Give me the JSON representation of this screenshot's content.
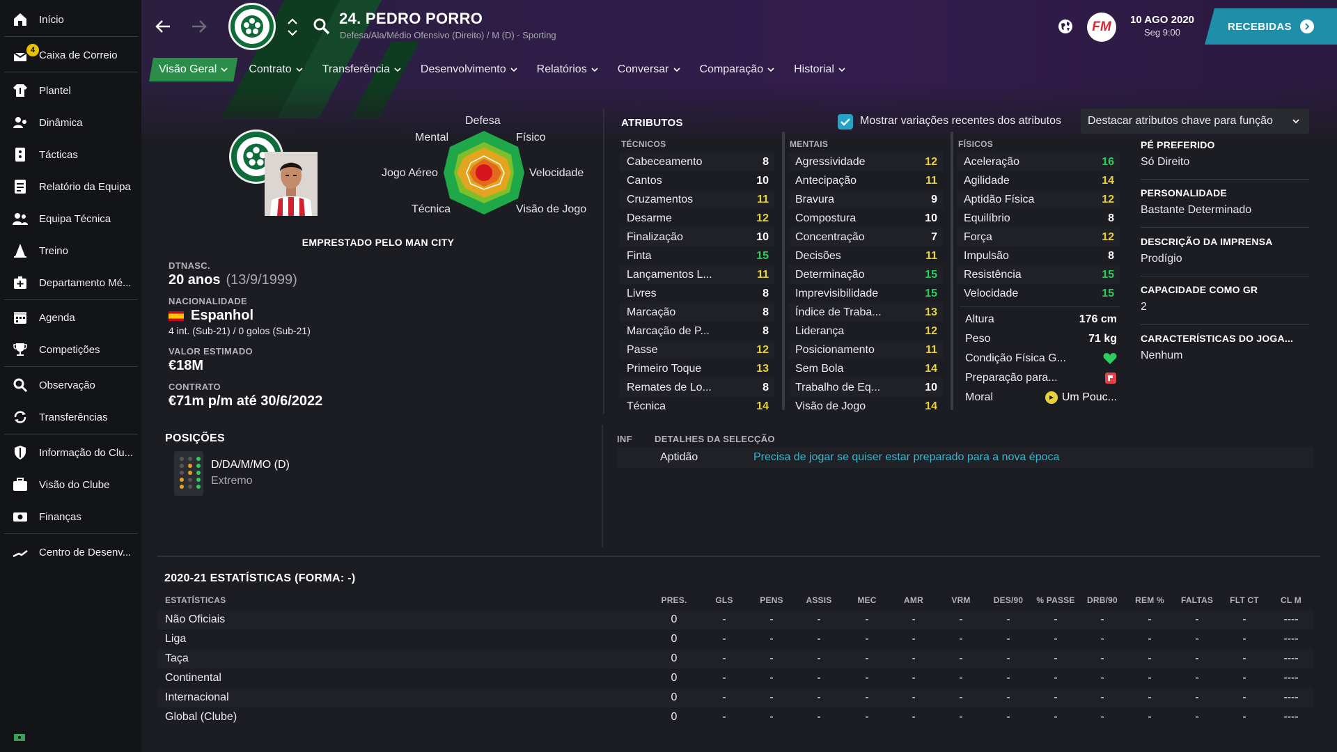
{
  "sidebar": {
    "items": [
      {
        "label": "Início",
        "icon": "home-icon"
      },
      {
        "label": "Caixa de Correio",
        "icon": "inbox-icon",
        "badge": "4"
      },
      {
        "label": "Plantel",
        "icon": "shirt-icon"
      },
      {
        "label": "Dinâmica",
        "icon": "dynamics-icon"
      },
      {
        "label": "Tácticas",
        "icon": "tactics-icon"
      },
      {
        "label": "Relatório da Equipa",
        "icon": "report-icon"
      },
      {
        "label": "Equipa Técnica",
        "icon": "staff-icon"
      },
      {
        "label": "Treino",
        "icon": "training-cone-icon"
      },
      {
        "label": "Departamento Mé...",
        "icon": "medical-icon"
      },
      {
        "label": "Agenda",
        "icon": "calendar-icon"
      },
      {
        "label": "Competições",
        "icon": "trophy-icon"
      },
      {
        "label": "Observação",
        "icon": "scouting-search-icon"
      },
      {
        "label": "Transferências",
        "icon": "transfers-icon"
      },
      {
        "label": "Informação do Clu...",
        "icon": "club-shield-icon"
      },
      {
        "label": "Visão do Clube",
        "icon": "briefcase-icon"
      },
      {
        "label": "Finanças",
        "icon": "money-icon"
      },
      {
        "label": "Centro de Desenv...",
        "icon": "development-icon"
      }
    ]
  },
  "header": {
    "player_name": "24. PEDRO PORRO",
    "player_subtitle": "Defesa/Ala/Médio Ofensivo (Direito) / M (D) - Sporting",
    "fm_logo": "FM",
    "date_main": "10 AGO 2020",
    "date_sub": "Seg 9:00",
    "received_label": "RECEBIDAS"
  },
  "tabs": [
    {
      "label": "Visão Geral",
      "active": true
    },
    {
      "label": "Contrato"
    },
    {
      "label": "Transferência"
    },
    {
      "label": "Desenvolvimento"
    },
    {
      "label": "Relatórios"
    },
    {
      "label": "Conversar"
    },
    {
      "label": "Comparação"
    },
    {
      "label": "Historial"
    }
  ],
  "profile": {
    "loan_text": "EMPRESTADO PELO MAN CITY",
    "radar_labels": {
      "defesa": "Defesa",
      "fisico": "Físico",
      "velocidade": "Velocidade",
      "visao": "Visão de Jogo",
      "tecnica": "Técnica",
      "jogo_aereo": "Jogo Aéreo",
      "mental": "Mental"
    },
    "dob_label": "DTNASC.",
    "age": "20 anos",
    "dob": "(13/9/1999)",
    "nationality_label": "NACIONALIDADE",
    "nationality": "Espanhol",
    "caps": "4 int. (Sub-21) / 0 golos (Sub-21)",
    "value_label": "VALOR ESTIMADO",
    "value": "€18M",
    "contract_label": "CONTRATO",
    "contract": "€71m p/m até 30/6/2022"
  },
  "attributes": {
    "title": "ATRIBUTOS",
    "show_changes_label": "Mostrar variações recentes dos atributos",
    "show_changes_checked": true,
    "highlight_dropdown": "Destacar atributos chave para função",
    "technical_label": "TÉCNICOS",
    "mental_label": "MENTAIS",
    "physical_label": "FÍSICOS",
    "technical": [
      {
        "name": "Cabeceamento",
        "value": "8"
      },
      {
        "name": "Cantos",
        "value": "10"
      },
      {
        "name": "Cruzamentos",
        "value": "11"
      },
      {
        "name": "Desarme",
        "value": "12"
      },
      {
        "name": "Finalização",
        "value": "10"
      },
      {
        "name": "Finta",
        "value": "15"
      },
      {
        "name": "Lançamentos L...",
        "value": "11"
      },
      {
        "name": "Livres",
        "value": "8"
      },
      {
        "name": "Marcação",
        "value": "8"
      },
      {
        "name": "Marcação de P...",
        "value": "8"
      },
      {
        "name": "Passe",
        "value": "12"
      },
      {
        "name": "Primeiro Toque",
        "value": "13"
      },
      {
        "name": "Remates de Lo...",
        "value": "8"
      },
      {
        "name": "Técnica",
        "value": "14"
      }
    ],
    "mental": [
      {
        "name": "Agressividade",
        "value": "12"
      },
      {
        "name": "Antecipação",
        "value": "11"
      },
      {
        "name": "Bravura",
        "value": "9"
      },
      {
        "name": "Compostura",
        "value": "10"
      },
      {
        "name": "Concentração",
        "value": "7"
      },
      {
        "name": "Decisões",
        "value": "11"
      },
      {
        "name": "Determinação",
        "value": "15"
      },
      {
        "name": "Imprevisibilidade",
        "value": "15"
      },
      {
        "name": "Índice de Traba...",
        "value": "13"
      },
      {
        "name": "Liderança",
        "value": "12"
      },
      {
        "name": "Posicionamento",
        "value": "11"
      },
      {
        "name": "Sem Bola",
        "value": "14"
      },
      {
        "name": "Trabalho de Eq...",
        "value": "10"
      },
      {
        "name": "Visão de Jogo",
        "value": "14"
      }
    ],
    "physical": [
      {
        "name": "Aceleração",
        "value": "16"
      },
      {
        "name": "Agilidade",
        "value": "14"
      },
      {
        "name": "Aptidão Física",
        "value": "12"
      },
      {
        "name": "Equilíbrio",
        "value": "8"
      },
      {
        "name": "Força",
        "value": "12"
      },
      {
        "name": "Impulsão",
        "value": "8"
      },
      {
        "name": "Resistência",
        "value": "15"
      },
      {
        "name": "Velocidade",
        "value": "15"
      }
    ],
    "extra": {
      "height_label": "Altura",
      "height": "176 cm",
      "weight_label": "Peso",
      "weight": "71 kg",
      "condition_label": "Condição Física G...",
      "preparation_label": "Preparação para...",
      "morale_label": "Moral",
      "morale": "Um Pouc..."
    },
    "colors": {
      "low": "#ffffff",
      "mid": "#e8d23c",
      "high": "#2ecc5d"
    }
  },
  "right_panel": {
    "foot_label": "PÉ PREFERIDO",
    "foot": "Só Direito",
    "personality_label": "PERSONALIDADE",
    "personality": "Bastante Determinado",
    "media_label": "DESCRIÇÃO DA IMPRENSA",
    "media": "Prodígio",
    "gk_label": "CAPACIDADE COMO GR",
    "gk": "2",
    "traits_label": "CARACTERÍSTICAS DO JOGA...",
    "traits": "Nenhum"
  },
  "positions": {
    "title": "POSIÇÕES",
    "main": "D/DA/M/MO (D)",
    "role": "Extremo"
  },
  "selection": {
    "inf_label": "INF",
    "header": "DETALHES DA SELECÇÃO",
    "key": "Aptidão",
    "detail": "Precisa de jogar se quiser estar preparado para a nova época"
  },
  "stats": {
    "title": "2020-21 ESTATÍSTICAS (FORMA: -)",
    "first_col": "ESTATÍSTICAS",
    "columns": [
      "PRES.",
      "GLS",
      "PENS",
      "ASSIS",
      "MEC",
      "AMR",
      "VRM",
      "DES/90",
      "% PASSE",
      "DRB/90",
      "REM %",
      "FALTAS",
      "FLT CT",
      "CL M"
    ],
    "rows": [
      {
        "name": "Não Oficiais",
        "values": [
          "0",
          "-",
          "-",
          "-",
          "-",
          "-",
          "-",
          "-",
          "-",
          "-",
          "-",
          "-",
          "-",
          "----"
        ]
      },
      {
        "name": "Liga",
        "values": [
          "0",
          "-",
          "-",
          "-",
          "-",
          "-",
          "-",
          "-",
          "-",
          "-",
          "-",
          "-",
          "-",
          "----"
        ]
      },
      {
        "name": "Taça",
        "values": [
          "0",
          "-",
          "-",
          "-",
          "-",
          "-",
          "-",
          "-",
          "-",
          "-",
          "-",
          "-",
          "-",
          "----"
        ]
      },
      {
        "name": "Continental",
        "values": [
          "0",
          "-",
          "-",
          "-",
          "-",
          "-",
          "-",
          "-",
          "-",
          "-",
          "-",
          "-",
          "-",
          "----"
        ]
      },
      {
        "name": "Internacional",
        "values": [
          "0",
          "-",
          "-",
          "-",
          "-",
          "-",
          "-",
          "-",
          "-",
          "-",
          "-",
          "-",
          "-",
          "----"
        ]
      },
      {
        "name": "Global (Clube)",
        "values": [
          "0",
          "-",
          "-",
          "-",
          "-",
          "-",
          "-",
          "-",
          "-",
          "-",
          "-",
          "-",
          "-",
          "----"
        ]
      }
    ]
  }
}
